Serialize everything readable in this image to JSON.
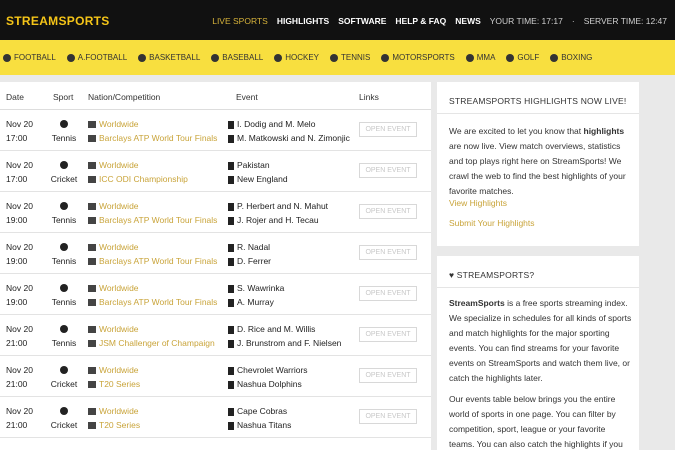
{
  "header": {
    "logo": "STREAMSPORTS",
    "nav": [
      "LIVE SPORTS",
      "HIGHLIGHTS",
      "SOFTWARE",
      "HELP & FAQ",
      "NEWS"
    ],
    "your_time": "YOUR TIME: 17:17",
    "server_time": "SERVER TIME: 12:47"
  },
  "sports": [
    "FOOTBALL",
    "A.FOOTBALL",
    "BASKETBALL",
    "BASEBALL",
    "HOCKEY",
    "TENNIS",
    "MOTORSPORTS",
    "MMA",
    "GOLF",
    "BOXING"
  ],
  "table": {
    "headers": {
      "date": "Date",
      "sport": "Sport",
      "competition": "Nation/Competition",
      "event": "Event",
      "links": "Links"
    },
    "rows": [
      {
        "date": "Nov 20",
        "time": "17:00",
        "sport": "Tennis",
        "nation": "Worldwide",
        "competition": "Barclays ATP World Tour Finals",
        "team1": "I. Dodig and M. Melo",
        "team2": "M. Matkowski and N. Zimonjic",
        "link": "OPEN EVENT"
      },
      {
        "date": "Nov 20",
        "time": "17:00",
        "sport": "Cricket",
        "nation": "Worldwide",
        "competition": "ICC ODI Championship",
        "team1": "Pakistan",
        "team2": "New England",
        "link": "OPEN EVENT"
      },
      {
        "date": "Nov 20",
        "time": "19:00",
        "sport": "Tennis",
        "nation": "Worldwide",
        "competition": "Barclays ATP World Tour Finals",
        "team1": "P. Herbert and N. Mahut",
        "team2": "J. Rojer and H. Tecau",
        "link": "OPEN EVENT"
      },
      {
        "date": "Nov 20",
        "time": "19:00",
        "sport": "Tennis",
        "nation": "Worldwide",
        "competition": "Barclays ATP World Tour Finals",
        "team1": "R. Nadal",
        "team2": "D. Ferrer",
        "link": "OPEN EVENT"
      },
      {
        "date": "Nov 20",
        "time": "19:00",
        "sport": "Tennis",
        "nation": "Worldwide",
        "competition": "Barclays ATP World Tour Finals",
        "team1": "S. Wawrinka",
        "team2": "A. Murray",
        "link": "OPEN EVENT"
      },
      {
        "date": "Nov 20",
        "time": "21:00",
        "sport": "Tennis",
        "nation": "Worldwide",
        "competition": "JSM Challenger of Champaign",
        "team1": "D. Rice and M. Willis",
        "team2": "J. Brunstrom and F. Nielsen",
        "link": "OPEN EVENT"
      },
      {
        "date": "Nov 20",
        "time": "21:00",
        "sport": "Cricket",
        "nation": "Worldwide",
        "competition": "T20 Series",
        "team1": "Chevrolet Warriors",
        "team2": "Nashua Dolphins",
        "link": "OPEN EVENT"
      },
      {
        "date": "Nov 20",
        "time": "21:00",
        "sport": "Cricket",
        "nation": "Worldwide",
        "competition": "T20 Series",
        "team1": "Cape Cobras",
        "team2": "Nashua Titans",
        "link": "OPEN EVENT"
      }
    ]
  },
  "highlights_box": {
    "title": "STREAMSPORTS HIGHLIGHTS NOW LIVE!",
    "text_a": "We are excited to let you know that ",
    "text_bold": "highlights",
    "text_b": " are now live. View match overviews, statistics and top plays right here on StreamSports! We crawl the web to find the best highlights of your favorite matches.",
    "link1": "View Highlights",
    "link2": "Submit Your Highlights"
  },
  "about_box": {
    "title": "♥ STREAMSPORTS?",
    "p1_bold": "StreamSports",
    "p1": " is a free sports streaming index. We specialize in schedules for all kinds of sports and match highlights for the major sporting events. You can find streams for your favorite events on StreamSports and watch them live, or catch the highlights later.",
    "p2": "Our events table below brings you the entire world of sports in one page. You can filter by competition, sport, league or your favorite teams. You can also catch the highlights if you missed the live event."
  }
}
